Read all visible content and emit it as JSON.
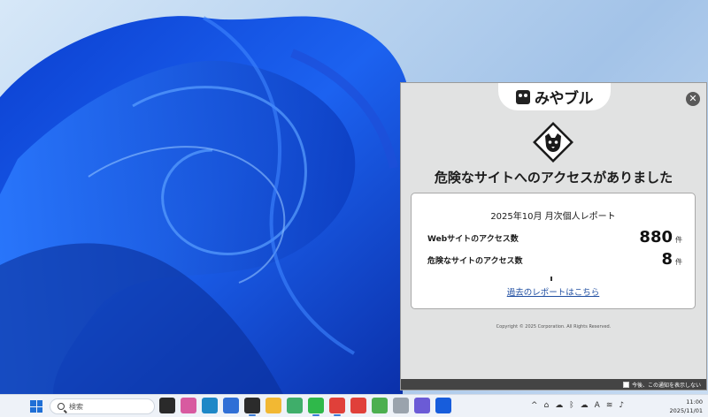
{
  "taskbar": {
    "search_placeholder": "検索",
    "time": "11:00",
    "date": "2025/11/01",
    "tray_glyphs": [
      "^",
      "A"
    ],
    "apps": [
      {
        "name": "task-view-icon",
        "color": "#2a2a2a"
      },
      {
        "name": "copilot-icon",
        "color": "#d85aa0"
      },
      {
        "name": "edge-icon",
        "color": "#1e88c7"
      },
      {
        "name": "todo-icon",
        "color": "#2f6fd6"
      },
      {
        "name": "terminal-icon",
        "color": "#2b2b2b"
      },
      {
        "name": "file-explorer-icon",
        "color": "#f2b833"
      },
      {
        "name": "puzzle-app-icon",
        "color": "#3fae6a"
      },
      {
        "name": "line-icon",
        "color": "#2fb84a"
      },
      {
        "name": "vivaldi-icon",
        "color": "#e0403a"
      },
      {
        "name": "vivaldi-alt-icon",
        "color": "#e0403a"
      },
      {
        "name": "chrome-icon",
        "color": "#4caf50"
      },
      {
        "name": "pen-app-icon",
        "color": "#9aa3ad"
      },
      {
        "name": "phone-icon",
        "color": "#6b5bd6"
      },
      {
        "name": "bitwarden-icon",
        "color": "#175ddc"
      }
    ]
  },
  "popup": {
    "logo_text": "みやブル",
    "heading": "危険なサイトへのアクセスがありました",
    "report": {
      "title": "2025年10月 月次個人レポート",
      "rows": [
        {
          "label": "Webサイトのアクセス数",
          "value": "880",
          "unit": "件"
        },
        {
          "label": "危険なサイトのアクセス数",
          "value": "8",
          "unit": "件"
        }
      ],
      "link": "過去のレポートはこちら"
    },
    "copyright": "Copyright © 2025 Corporation. All Rights Reserved.",
    "dont_show_label": "今後、この通知を表示しない"
  }
}
